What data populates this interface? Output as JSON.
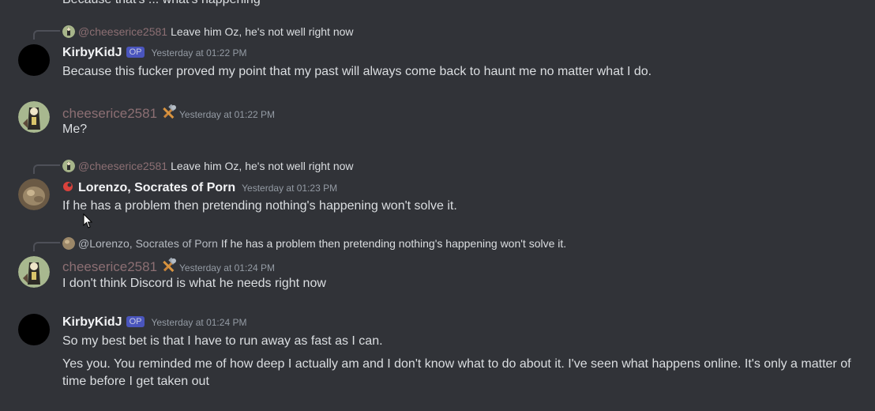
{
  "top_partial_text": "Because that's ... what's happening",
  "messages": [
    {
      "reply": {
        "author": "@cheeserice2581",
        "text": "Leave him Oz, he's not well right now"
      },
      "author": "KirbyKidJ",
      "badge": "OP",
      "timestamp": "Yesterday at 01:22 PM",
      "lines": [
        "Because this fucker proved my point that my past will always come back to haunt me no matter what I do."
      ]
    },
    {
      "author": "cheeserice2581",
      "role_icon": "hammer-wrench-icon",
      "timestamp": "Yesterday at 01:22 PM",
      "lines": [
        "Me?"
      ]
    },
    {
      "reply": {
        "author": "@cheeserice2581",
        "text": "Leave him Oz, he's not well right now"
      },
      "author": "Lorenzo, Socrates of Porn",
      "role_icon": "red-role-icon",
      "timestamp": "Yesterday at 01:23 PM",
      "lines": [
        "If he has a problem then pretending nothing's happening won't solve it."
      ]
    },
    {
      "reply": {
        "author": "@Lorenzo, Socrates of Porn",
        "text": "If he has a problem then pretending nothing's happening won't solve it."
      },
      "author": "cheeserice2581",
      "role_icon": "hammer-wrench-icon",
      "timestamp": "Yesterday at 01:24 PM",
      "lines": [
        "I don't think Discord is what he needs right now"
      ]
    },
    {
      "author": "KirbyKidJ",
      "badge": "OP",
      "timestamp": "Yesterday at 01:24 PM",
      "lines": [
        "So my best bet is that I have to run away as fast as I can.",
        "Yes you. You reminded me of how deep I actually am and I don't know what to do about it. I've seen what happens online. It's only a matter of time before I get taken out"
      ]
    }
  ],
  "colors": {
    "background": "#313338",
    "text": "#dbdee1",
    "cheese_name": "#8c6f73",
    "timestamp": "#949ba4",
    "op_badge": "#4f5bd5"
  }
}
